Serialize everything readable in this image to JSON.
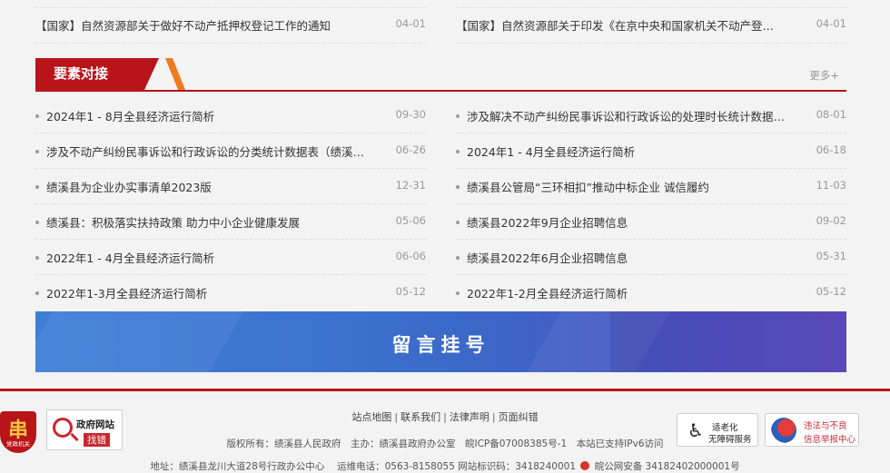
{
  "top_news": [
    {
      "title": "【国家】自然资源部关于做好不动产抵押权登记工作的通知",
      "date": "04-01"
    },
    {
      "title": "【国家】自然资源部关于印发《在京中央和国家机关不动产登记办法…",
      "date": "04-01"
    }
  ],
  "section": {
    "title": "要素对接",
    "more": "更多+"
  },
  "left_list": [
    {
      "title": "2024年1 - 8月全县经济运行简析",
      "date": "09-30"
    },
    {
      "title": "涉及不动产纠纷民事诉讼和行政诉讼的分类统计数据表（绩溪县）",
      "date": "06-26"
    },
    {
      "title": "绩溪县为企业办实事清单2023版",
      "date": "12-31"
    },
    {
      "title": "绩溪县：积极落实扶持政策 助力中小企业健康发展",
      "date": "05-06"
    },
    {
      "title": "2022年1 - 4月全县经济运行简析",
      "date": "06-06"
    },
    {
      "title": "2022年1-3月全县经济运行简析",
      "date": "05-12"
    }
  ],
  "right_list": [
    {
      "title": "涉及解决不动产纠纷民事诉讼和行政诉讼的处理时长统计数据表（绩…",
      "date": "08-01"
    },
    {
      "title": "2024年1 - 4月全县经济运行简析",
      "date": "06-18"
    },
    {
      "title": "绩溪县公管局“三环相扣”推动中标企业 诚信履约",
      "date": "11-03"
    },
    {
      "title": "绩溪县2022年9月企业招聘信息",
      "date": "09-02"
    },
    {
      "title": "绩溪县2022年6月企业招聘信息",
      "date": "05-31"
    },
    {
      "title": "2022年1-2月全县经济运行简析",
      "date": "05-12"
    }
  ],
  "banner": {
    "text": "留言挂号"
  },
  "footer": {
    "links": [
      "站点地图",
      "联系我们",
      "法律声明",
      "页面纠错"
    ],
    "line1": "版权所有：绩溪县人民政府　主办：绩溪县政府办公室　皖ICP备07008385号-1　本站已支持IPv6访问",
    "line2_a": "地址：绩溪县龙川大道28号行政办公中心　 运维电话：0563-8158055 网站标识码：3418240001",
    "line2_b": "皖公网安备 34182402000001号",
    "emblem_glyph": "串",
    "emblem_caption": "党政机关",
    "badge_zc": {
      "line1": "政府网站",
      "line2": "找错"
    },
    "badge_wza": {
      "line1": "适老化",
      "line2": "无障碍服务"
    },
    "badge_jb": {
      "line1": "违法与不良",
      "line2": "信息举报中心"
    }
  },
  "colors": {
    "brand_red": "#b8141a",
    "accent_orange": "#ef7a22",
    "banner_blue": "#3c73cf"
  }
}
